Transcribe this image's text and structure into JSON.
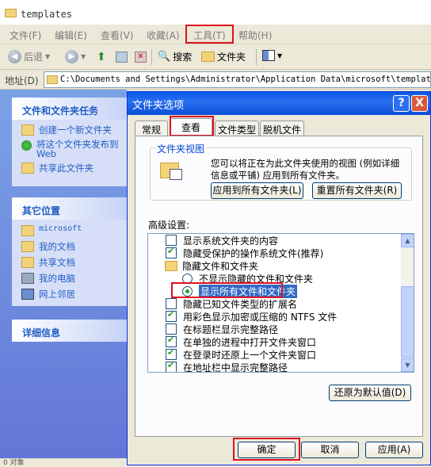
{
  "window": {
    "title": "templates"
  },
  "menu": {
    "file": "文件(F)",
    "edit": "编辑(E)",
    "view": "查看(V)",
    "favorites": "收藏(A)",
    "tools": "工具(T)",
    "help": "帮助(H)"
  },
  "toolbar": {
    "back": "后退",
    "search": "搜索",
    "folders": "文件夹"
  },
  "address": {
    "label": "地址(D)",
    "path": "C:\\Documents and Settings\\Administrator\\Application Data\\microsoft\\templates"
  },
  "left": {
    "tasks_title": "文件和文件夹任务",
    "tasks": [
      "创建一个新文件夹",
      "将这个文件夹发布到",
      "Web",
      "共享此文件夹"
    ],
    "places_title": "其它位置",
    "places": [
      "microsoft",
      "我的文档",
      "共享文档",
      "我的电脑",
      "网上邻居"
    ],
    "details_title": "详细信息"
  },
  "dialog": {
    "title": "文件夹选项",
    "help_btn": "?",
    "close_btn": "X",
    "tabs": [
      "常规",
      "查看",
      "文件类型",
      "脱机文件"
    ],
    "group_title": "文件夹视图",
    "group_desc_1": "您可以将正在为此文件夹使用的视图 (例如详细",
    "group_desc_2": "信息或平铺) 应用到所有文件夹。",
    "apply_all": "应用到所有文件夹(L)",
    "reset_all": "重置所有文件夹(R)",
    "advanced_label": "高级设置:",
    "tree": [
      {
        "type": "check",
        "on": false,
        "label": "显示系统文件夹的内容"
      },
      {
        "type": "check",
        "on": true,
        "label": "隐藏受保护的操作系统文件(推荐)"
      },
      {
        "type": "folder",
        "label": "隐藏文件和文件夹"
      },
      {
        "type": "radio",
        "on": false,
        "label": "不显示隐藏的文件和文件夹"
      },
      {
        "type": "radio",
        "on": true,
        "label": "显示所有文件和文件夹"
      },
      {
        "type": "check",
        "on": false,
        "label": "隐藏已知文件类型的扩展名"
      },
      {
        "type": "check",
        "on": true,
        "label": "用彩色显示加密或压缩的 NTFS 文件"
      },
      {
        "type": "check",
        "on": false,
        "label": "在标题栏显示完整路径"
      },
      {
        "type": "check",
        "on": true,
        "label": "在单独的进程中打开文件夹窗口"
      },
      {
        "type": "check",
        "on": true,
        "label": "在登录时还原上一个文件夹窗口"
      },
      {
        "type": "check",
        "on": true,
        "label": "在地址栏中显示完整路径"
      }
    ],
    "restore_defaults": "还原为默认值(D)",
    "ok": "确定",
    "cancel": "取消",
    "apply": "应用(A)"
  },
  "status": {
    "text": "0 对象"
  },
  "colors": {
    "highlight": "#e01020",
    "selection": "#316ac5",
    "title_blue": "#0a58e6"
  }
}
